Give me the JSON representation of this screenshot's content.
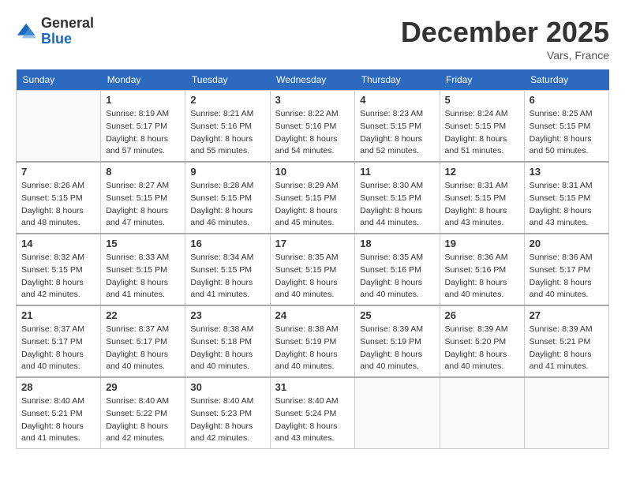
{
  "header": {
    "logo_general": "General",
    "logo_blue": "Blue",
    "month": "December 2025",
    "location": "Vars, France"
  },
  "weekdays": [
    "Sunday",
    "Monday",
    "Tuesday",
    "Wednesday",
    "Thursday",
    "Friday",
    "Saturday"
  ],
  "weeks": [
    [
      {
        "day": "",
        "info": ""
      },
      {
        "day": "1",
        "info": "Sunrise: 8:19 AM\nSunset: 5:17 PM\nDaylight: 8 hours\nand 57 minutes."
      },
      {
        "day": "2",
        "info": "Sunrise: 8:21 AM\nSunset: 5:16 PM\nDaylight: 8 hours\nand 55 minutes."
      },
      {
        "day": "3",
        "info": "Sunrise: 8:22 AM\nSunset: 5:16 PM\nDaylight: 8 hours\nand 54 minutes."
      },
      {
        "day": "4",
        "info": "Sunrise: 8:23 AM\nSunset: 5:15 PM\nDaylight: 8 hours\nand 52 minutes."
      },
      {
        "day": "5",
        "info": "Sunrise: 8:24 AM\nSunset: 5:15 PM\nDaylight: 8 hours\nand 51 minutes."
      },
      {
        "day": "6",
        "info": "Sunrise: 8:25 AM\nSunset: 5:15 PM\nDaylight: 8 hours\nand 50 minutes."
      }
    ],
    [
      {
        "day": "7",
        "info": "Sunrise: 8:26 AM\nSunset: 5:15 PM\nDaylight: 8 hours\nand 48 minutes."
      },
      {
        "day": "8",
        "info": "Sunrise: 8:27 AM\nSunset: 5:15 PM\nDaylight: 8 hours\nand 47 minutes."
      },
      {
        "day": "9",
        "info": "Sunrise: 8:28 AM\nSunset: 5:15 PM\nDaylight: 8 hours\nand 46 minutes."
      },
      {
        "day": "10",
        "info": "Sunrise: 8:29 AM\nSunset: 5:15 PM\nDaylight: 8 hours\nand 45 minutes."
      },
      {
        "day": "11",
        "info": "Sunrise: 8:30 AM\nSunset: 5:15 PM\nDaylight: 8 hours\nand 44 minutes."
      },
      {
        "day": "12",
        "info": "Sunrise: 8:31 AM\nSunset: 5:15 PM\nDaylight: 8 hours\nand 43 minutes."
      },
      {
        "day": "13",
        "info": "Sunrise: 8:31 AM\nSunset: 5:15 PM\nDaylight: 8 hours\nand 43 minutes."
      }
    ],
    [
      {
        "day": "14",
        "info": "Sunrise: 8:32 AM\nSunset: 5:15 PM\nDaylight: 8 hours\nand 42 minutes."
      },
      {
        "day": "15",
        "info": "Sunrise: 8:33 AM\nSunset: 5:15 PM\nDaylight: 8 hours\nand 41 minutes."
      },
      {
        "day": "16",
        "info": "Sunrise: 8:34 AM\nSunset: 5:15 PM\nDaylight: 8 hours\nand 41 minutes."
      },
      {
        "day": "17",
        "info": "Sunrise: 8:35 AM\nSunset: 5:15 PM\nDaylight: 8 hours\nand 40 minutes."
      },
      {
        "day": "18",
        "info": "Sunrise: 8:35 AM\nSunset: 5:16 PM\nDaylight: 8 hours\nand 40 minutes."
      },
      {
        "day": "19",
        "info": "Sunrise: 8:36 AM\nSunset: 5:16 PM\nDaylight: 8 hours\nand 40 minutes."
      },
      {
        "day": "20",
        "info": "Sunrise: 8:36 AM\nSunset: 5:17 PM\nDaylight: 8 hours\nand 40 minutes."
      }
    ],
    [
      {
        "day": "21",
        "info": "Sunrise: 8:37 AM\nSunset: 5:17 PM\nDaylight: 8 hours\nand 40 minutes."
      },
      {
        "day": "22",
        "info": "Sunrise: 8:37 AM\nSunset: 5:17 PM\nDaylight: 8 hours\nand 40 minutes."
      },
      {
        "day": "23",
        "info": "Sunrise: 8:38 AM\nSunset: 5:18 PM\nDaylight: 8 hours\nand 40 minutes."
      },
      {
        "day": "24",
        "info": "Sunrise: 8:38 AM\nSunset: 5:19 PM\nDaylight: 8 hours\nand 40 minutes."
      },
      {
        "day": "25",
        "info": "Sunrise: 8:39 AM\nSunset: 5:19 PM\nDaylight: 8 hours\nand 40 minutes."
      },
      {
        "day": "26",
        "info": "Sunrise: 8:39 AM\nSunset: 5:20 PM\nDaylight: 8 hours\nand 40 minutes."
      },
      {
        "day": "27",
        "info": "Sunrise: 8:39 AM\nSunset: 5:21 PM\nDaylight: 8 hours\nand 41 minutes."
      }
    ],
    [
      {
        "day": "28",
        "info": "Sunrise: 8:40 AM\nSunset: 5:21 PM\nDaylight: 8 hours\nand 41 minutes."
      },
      {
        "day": "29",
        "info": "Sunrise: 8:40 AM\nSunset: 5:22 PM\nDaylight: 8 hours\nand 42 minutes."
      },
      {
        "day": "30",
        "info": "Sunrise: 8:40 AM\nSunset: 5:23 PM\nDaylight: 8 hours\nand 42 minutes."
      },
      {
        "day": "31",
        "info": "Sunrise: 8:40 AM\nSunset: 5:24 PM\nDaylight: 8 hours\nand 43 minutes."
      },
      {
        "day": "",
        "info": ""
      },
      {
        "day": "",
        "info": ""
      },
      {
        "day": "",
        "info": ""
      }
    ]
  ]
}
